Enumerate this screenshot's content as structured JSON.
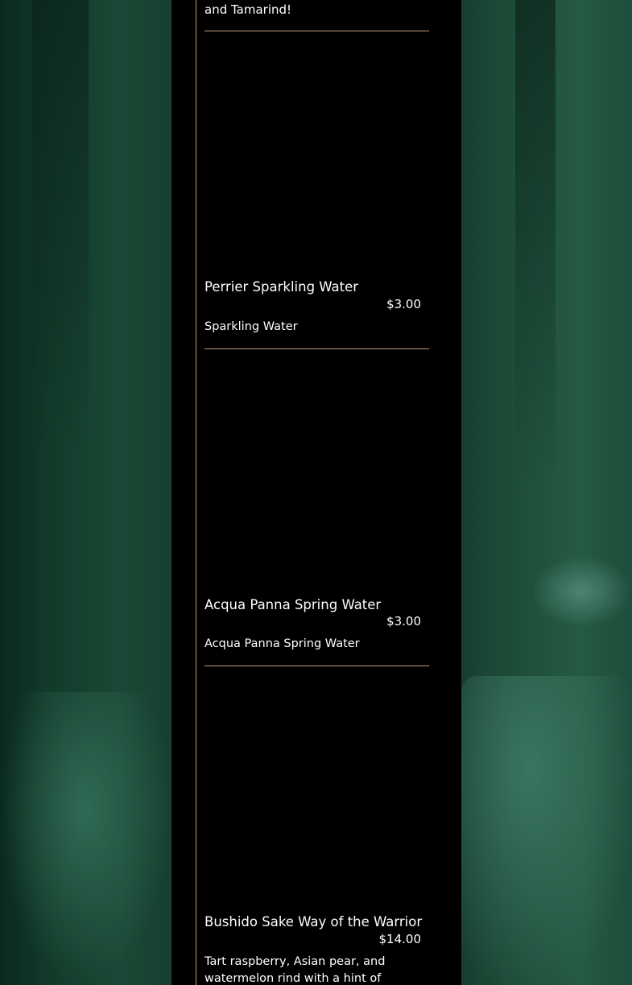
{
  "menu": {
    "top_fragment": "and Tamarind!",
    "items": [
      {
        "name": "Perrier Sparkling Water",
        "price": "$3.00",
        "description": "Sparkling Water"
      },
      {
        "name": "Acqua Panna Spring Water",
        "price": "$3.00",
        "description": "Acqua Panna Spring Water"
      },
      {
        "name": "Bushido Sake Way of the Warrior",
        "price": "$14.00",
        "description": "Tart raspberry, Asian pear, and watermelon rind with a hint of"
      }
    ]
  },
  "colors": {
    "panel_background": "#000000",
    "accent_line": "#c99a72",
    "text": "#ffffff"
  }
}
